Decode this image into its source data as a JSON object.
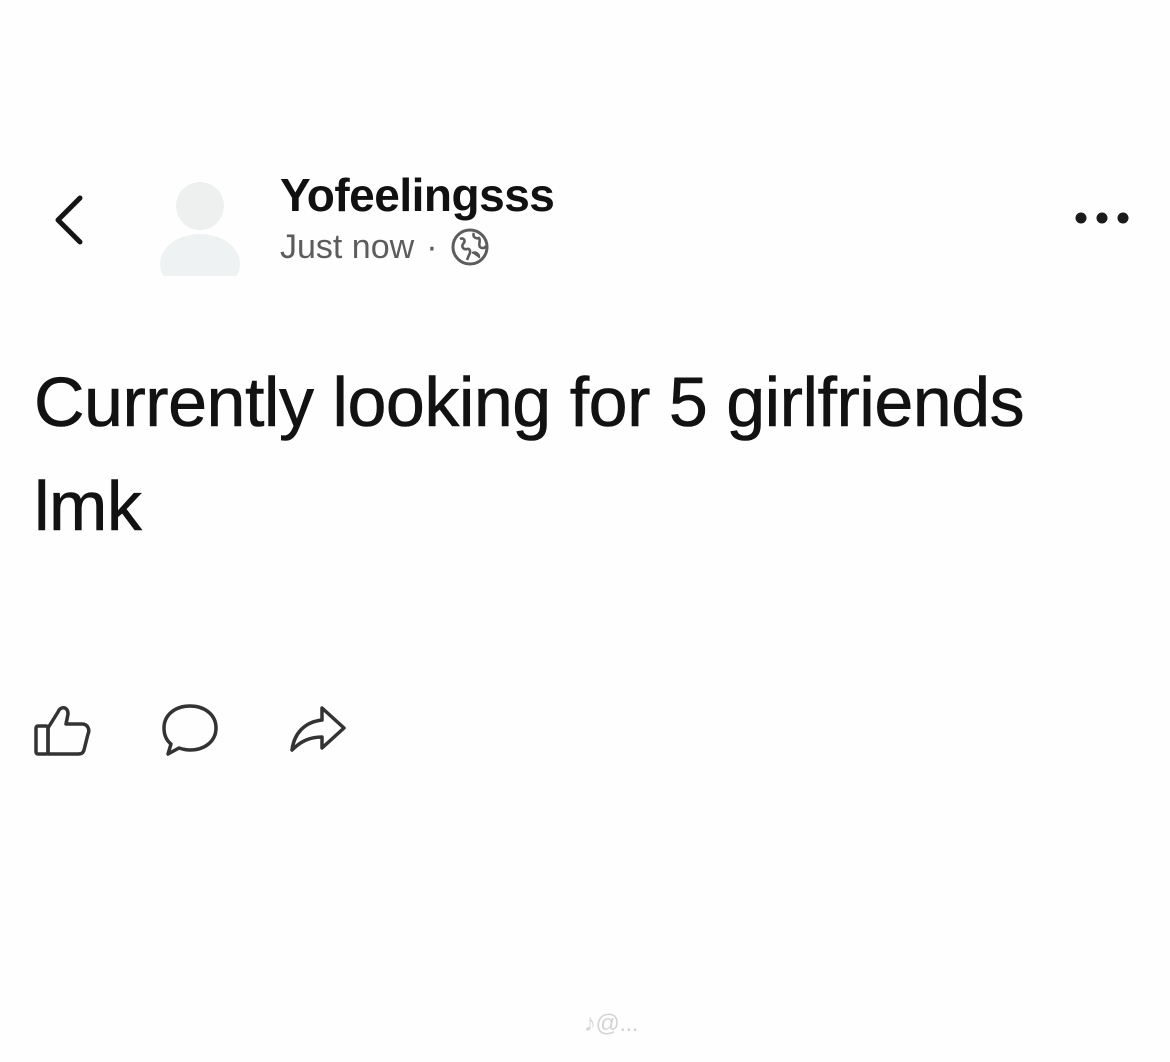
{
  "header": {
    "back_icon": "chevron-left-icon",
    "more_icon": "more-horizontal-icon"
  },
  "post": {
    "author_name": "Yofeelingsss",
    "time": "Just now",
    "separator": "·",
    "privacy_icon": "globe-icon",
    "text": "Currently looking for 5 girlfriends lmk"
  },
  "actions": [
    {
      "icon": "thumbs-up-icon"
    },
    {
      "icon": "comment-icon"
    },
    {
      "icon": "share-icon"
    }
  ],
  "watermark": "♪@..."
}
